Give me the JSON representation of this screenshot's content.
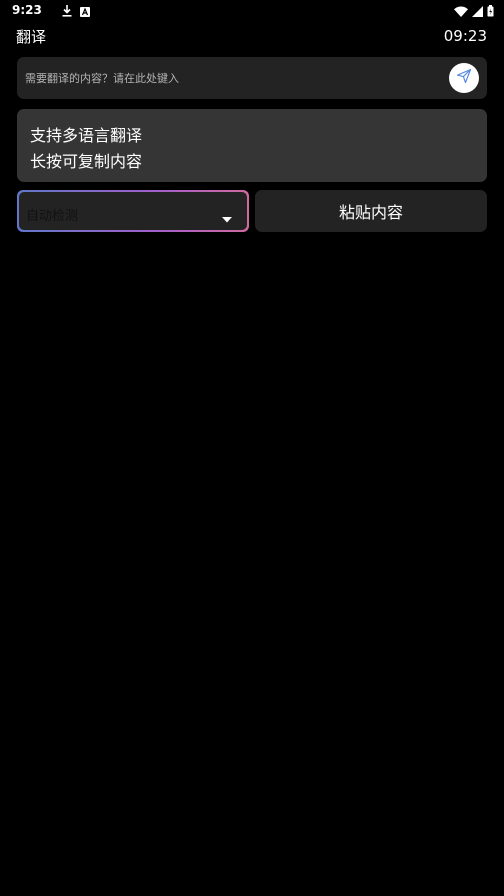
{
  "status_bar": {
    "time": "9:23",
    "left_icons": [
      "download-icon",
      "font-icon"
    ],
    "right_icons": [
      "wifi-icon",
      "signal-icon",
      "battery-icon"
    ]
  },
  "header": {
    "title": "翻译",
    "clock": "09:23"
  },
  "input": {
    "placeholder": "需要翻译的内容？请在此处键入",
    "value": "",
    "send_icon": "send-icon"
  },
  "result": {
    "lines": [
      "支持多语言翻译",
      "长按可复制内容"
    ]
  },
  "controls": {
    "language_selected": "自动检测",
    "paste_label": "粘贴内容"
  },
  "colors": {
    "background": "#000000",
    "card": "#232323",
    "result_card": "#353535",
    "gradient_start": "#5f77c8",
    "gradient_mid": "#a35fc9",
    "gradient_end": "#d06aa0",
    "send_icon": "#5a8be0"
  }
}
